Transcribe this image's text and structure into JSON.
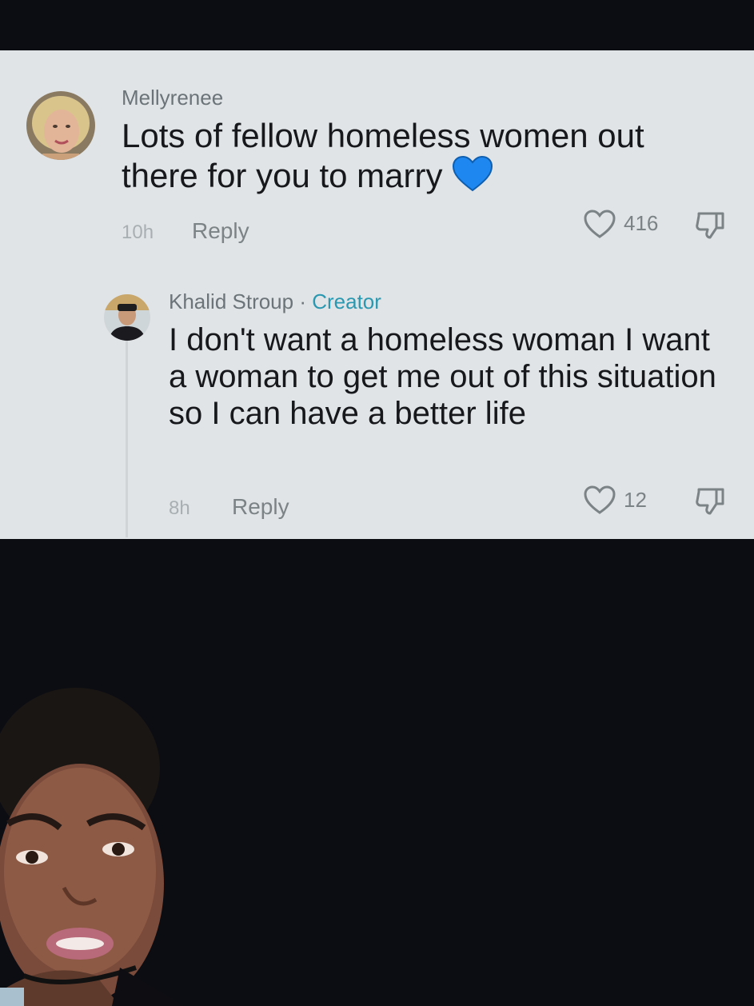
{
  "comment": {
    "username": "Mellyrenee",
    "text": "Lots of fellow homeless women out there for you to marry",
    "emoji": "💙",
    "time": "10h",
    "reply_label": "Reply",
    "likes": "416"
  },
  "reply": {
    "username": "Khalid Stroup",
    "separator": " · ",
    "creator_label": "Creator",
    "text": "I don't want a homeless woman I want a woman to get me out of this situation so I can have a better life",
    "time": "8h",
    "reply_label": "Reply",
    "likes": "12"
  },
  "icons": [
    "heart-outline-icon",
    "thumbs-down-icon"
  ],
  "colors": {
    "panel_bg": "#e1e4e6",
    "page_bg": "#0c0d12",
    "creator_accent": "#2a98b0",
    "emoji_heart": "#1e88f0"
  }
}
